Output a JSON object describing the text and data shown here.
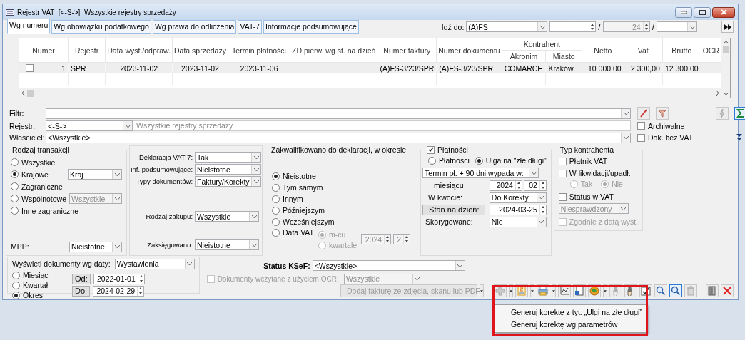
{
  "window": {
    "title": "Rejestr VAT  [<-S->]  Wszystkie rejestry sprzedaży"
  },
  "tabs": [
    {
      "label": "Wg numeru",
      "selected": true
    },
    {
      "label": "Wg obowiązku podatkowego",
      "selected": false
    },
    {
      "label": "Wg prawa do odliczenia",
      "selected": false
    },
    {
      "label": "VAT-7",
      "selected": false
    },
    {
      "label": "Informacje podsumowujące",
      "selected": false
    }
  ],
  "goto": {
    "label": "Idź do:",
    "series": "(A)FS",
    "separators": [
      "/",
      "/"
    ],
    "year": "24"
  },
  "table": {
    "column_group": {
      "label": "Kontrahent"
    },
    "columns": [
      {
        "label": "Numer"
      },
      {
        "label": "Rejestr"
      },
      {
        "label": "Data wyst./odpraw."
      },
      {
        "label": "Data sprzedaży"
      },
      {
        "label": "Termin płatności"
      },
      {
        "label": "ZD pierw. wg st. na dzień"
      },
      {
        "label": "Numer faktury"
      },
      {
        "label": "Numer dokumentu"
      },
      {
        "label": "Akronim",
        "grouped": true
      },
      {
        "label": "Miasto",
        "grouped": true
      },
      {
        "label": "Netto"
      },
      {
        "label": "Vat"
      },
      {
        "label": "Brutto"
      },
      {
        "label": "OCR"
      }
    ],
    "rows": [
      {
        "checked": false,
        "cells": [
          "1",
          "SPR",
          "2023-11-02",
          "2023-11-02",
          "2023-11-06",
          null,
          "(A)FS-3/23/SPR",
          "(A)FS-3/23/SPR",
          "COMARCH",
          "Kraków",
          "10 000,00",
          "2 300,00",
          "12 300,00",
          null
        ]
      }
    ]
  },
  "filters": {
    "filter": {
      "label": "Filtr:"
    },
    "register": {
      "label": "Rejestr:",
      "value": "<-S->",
      "description": "Wszystkie rejestry sprzedaży"
    },
    "owner": {
      "label": "Właściciel:",
      "value": "<Wszystkie>"
    },
    "checkboxes": [
      {
        "label": "Archiwalne",
        "checked": false
      },
      {
        "label": "Dok. bez VAT",
        "checked": false
      }
    ]
  },
  "transaction": {
    "title": "Rodzaj transakcji",
    "options": [
      {
        "label": "Wszystkie",
        "selected": false
      },
      {
        "label": "Krajowe",
        "selected": true,
        "combo": {
          "value": "Kraj",
          "disabled": false
        }
      },
      {
        "label": "Zagraniczne",
        "selected": false
      },
      {
        "label": "Wspólnotowe",
        "selected": false,
        "combo": {
          "value": "Wszystkie",
          "disabled": true
        }
      },
      {
        "label": "Inne zagraniczne",
        "selected": false
      }
    ],
    "mpp": {
      "label": "MPP:",
      "value": "Nieistotne"
    }
  },
  "declaration": {
    "fields": [
      {
        "label": "Deklaracja VAT-7:",
        "value": "Tak"
      },
      {
        "label": "Inf. podsumowujące:",
        "value": "Nieistotne"
      },
      {
        "label": "Typy dokumentów:",
        "value": "Faktury/Korekty"
      }
    ],
    "purchase": {
      "label": "Rodzaj zakupu:",
      "value": "Wszystkie"
    },
    "booked": {
      "label": "Zaksięgowano:",
      "value": "Nieistotne"
    }
  },
  "qualified": {
    "title": "Zakwalifikowano do deklaracji, w okresie",
    "options": [
      {
        "label": "Nieistotne",
        "selected": true
      },
      {
        "label": "Tym samym",
        "selected": false
      },
      {
        "label": "Innym",
        "selected": false
      },
      {
        "label": "Późniejszym",
        "selected": false
      },
      {
        "label": "Wcześniejszym",
        "selected": false
      },
      {
        "label": "Data VAT",
        "selected": false
      }
    ],
    "period": {
      "disabled": true,
      "options": [
        {
          "label": "m-cu",
          "selected": true
        },
        {
          "label": "kwartale",
          "selected": false
        }
      ],
      "year": "2024",
      "month": "2"
    }
  },
  "payments": {
    "title": "Płatności",
    "checked": true,
    "modes": [
      {
        "label": "Płatności",
        "selected": false
      },
      {
        "label": "Ulga na \"złe długi\"",
        "selected": true
      }
    ],
    "term": "Termin pł. + 90 dni wypada w:",
    "month_label": "miesiącu",
    "year": "2024",
    "month": "02",
    "amount_label": "W kwocie:",
    "amount": "Do Korekty",
    "state_button": "Stan na dzień:",
    "state_date": "2024-03-25",
    "corrected_label": "Skorygowane:",
    "corrected": "Nie"
  },
  "contractor": {
    "title": "Typ kontrahenta",
    "payer": {
      "label": "Płatnik VAT",
      "checked": false
    },
    "liquidation": {
      "label": "W likwidacji/upadł.",
      "checked": false,
      "disabled": true,
      "options": [
        {
          "label": "Tak",
          "selected": false
        },
        {
          "label": "Nie",
          "selected": true
        }
      ]
    },
    "vat_status": {
      "label": "Status w VAT",
      "checked": false,
      "value": "Niesprawdzony",
      "disabled": true
    },
    "consistent": {
      "label": "Zgodnie z datą wyst.",
      "checked": false,
      "disabled": true
    }
  },
  "dates": {
    "label": "Wyświetl dokumenty wg daty:",
    "value": "Wystawienia",
    "options": [
      {
        "label": "Miesiąc",
        "selected": false
      },
      {
        "label": "Kwartał",
        "selected": false
      },
      {
        "label": "Okres",
        "selected": true
      }
    ],
    "from": {
      "label": "Od:",
      "value": "2022-01-01"
    },
    "to": {
      "label": "Do:",
      "value": "2024-02-29"
    }
  },
  "ksef": {
    "label": "Status KSeF:",
    "value": "<Wszystkie>"
  },
  "ocr": {
    "label": "Dokumenty wczytane z użyciem OCR",
    "checked": false,
    "disabled": true,
    "value": "Wszystkie"
  },
  "toolbar": {
    "ocr_button": {
      "label": "Dodaj fakturę ze zdjęcia, skanu lub PDF",
      "disabled": true
    }
  },
  "menu": {
    "items": [
      "Generuj korektę z tyt. „Ulgi na złe długi”",
      "Generuj korektę wg parametrów"
    ]
  }
}
